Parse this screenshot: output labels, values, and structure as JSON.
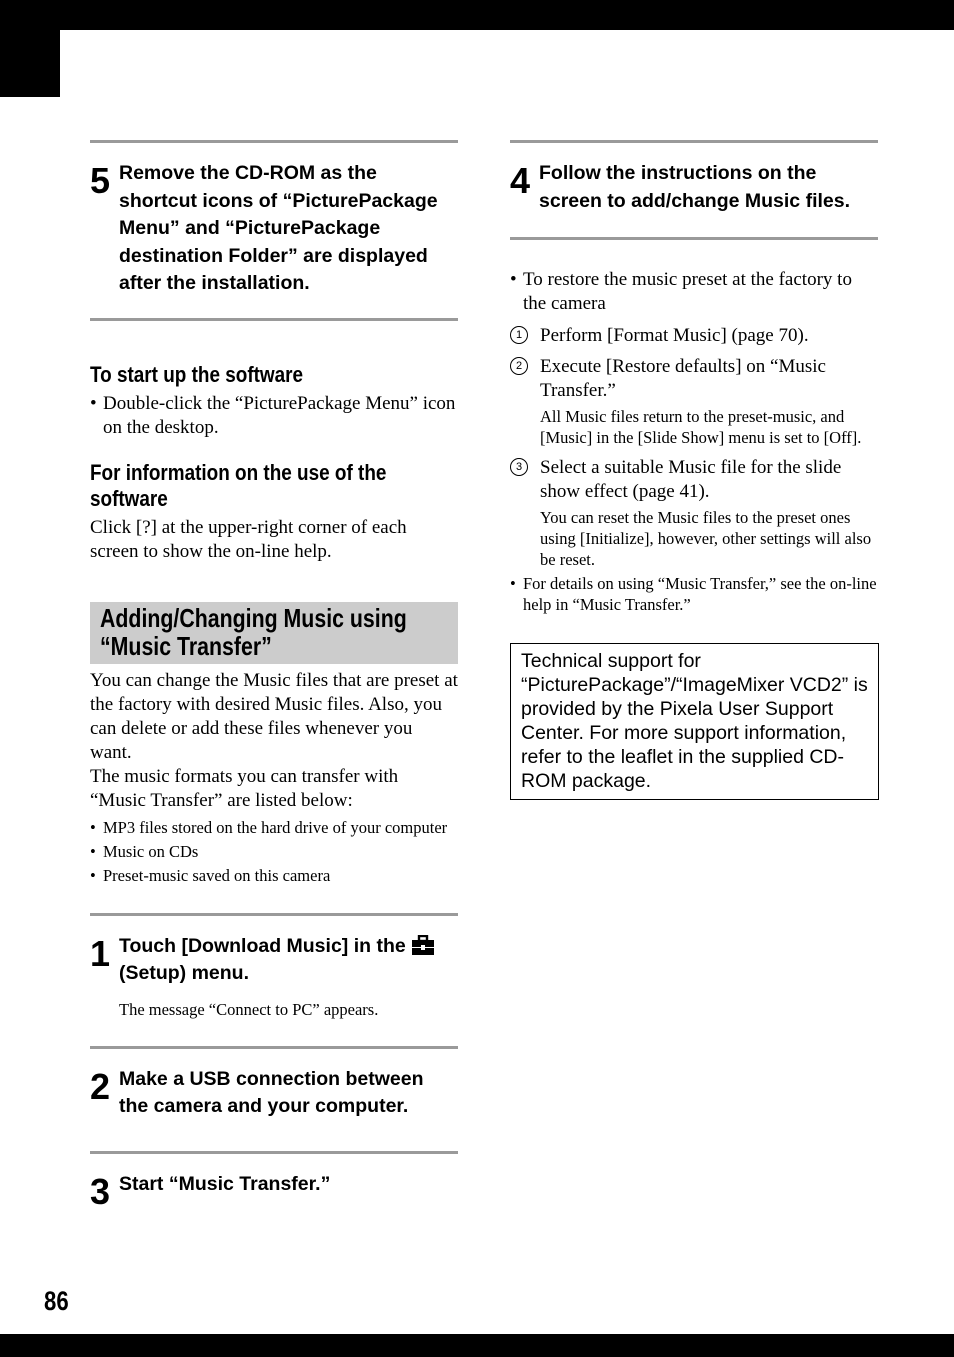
{
  "page": {
    "number": "86"
  },
  "left_column": {
    "step5": {
      "number": "5",
      "text": "Remove the CD-ROM as the shortcut icons of “PicturePackage Menu” and “PicturePackage destination Folder” are displayed after the installation."
    },
    "startup": {
      "heading": "To start up the software",
      "bullet": "Double-click the “PicturePackage Menu” icon on the desktop."
    },
    "info": {
      "heading": "For information on the use of the software",
      "text": "Click [?] at the upper-right corner of each screen to show the on-line help."
    },
    "section": {
      "title": "Adding/Changing Music using “Music Transfer”",
      "intro1": "You can change the Music files that are preset at the factory with desired Music files. Also, you can delete or add these files whenever you want.",
      "intro2": "The music formats you can transfer with “Music Transfer” are listed below:",
      "formats": [
        "MP3 files stored on the hard drive of your computer",
        "Music on CDs",
        "Preset-music saved on this camera"
      ]
    },
    "step1": {
      "number": "1",
      "text_before_icon": "Touch [Download Music] in the",
      "icon": "toolbox-setup-icon",
      "text_after_icon": "(Setup) menu.",
      "note": "The message “Connect to PC” appears."
    },
    "step2": {
      "number": "2",
      "text": "Make a USB connection between the camera and your computer."
    },
    "step3": {
      "number": "3",
      "text": "Start “Music Transfer.”"
    }
  },
  "right_column": {
    "step4": {
      "number": "4",
      "text": "Follow the instructions on the screen to add/change Music files."
    },
    "restore": {
      "bullet": "To restore the music preset at the factory to the camera",
      "items": [
        {
          "marker": "1",
          "text": "Perform [Format Music] (page 70).",
          "note": ""
        },
        {
          "marker": "2",
          "text": "Execute [Restore defaults] on “Music Transfer.”",
          "note": "All Music files return to the preset-music, and [Music] in the [Slide Show] menu is set to [Off]."
        },
        {
          "marker": "3",
          "text": "Select a suitable Music file for the slide show effect (page 41).",
          "note": "You can reset the Music files to the preset ones using [Initialize], however, other settings will also be reset."
        }
      ],
      "details_bullet": "For details on using “Music Transfer,” see the on-line help in “Music Transfer.”"
    },
    "support_box": "Technical support for “PicturePackage”/“ImageMixer VCD2” is provided by the Pixela User Support Center. For more support information, refer to the leaflet in the supplied CD-ROM package."
  }
}
